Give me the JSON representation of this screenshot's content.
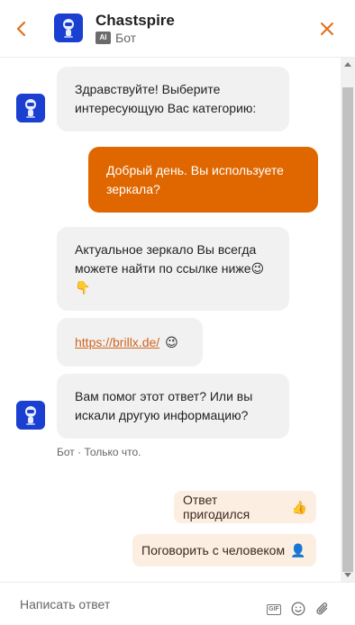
{
  "header": {
    "title": "Chastspire",
    "ai_badge": "AI",
    "subtitle": "Бот"
  },
  "messages": [
    {
      "sender": "bot",
      "text": "Здравствуйте! Выберите интересующую Вас категорию:"
    },
    {
      "sender": "user",
      "text": "Добрый день. Вы используете зеркала?"
    },
    {
      "sender": "bot",
      "text": "Актуальное зеркало Вы всегда можете найти по ссылке ниже",
      "emojis": "😉 👇"
    },
    {
      "sender": "bot",
      "link": "https://brillx.de/",
      "emoji": "😉"
    },
    {
      "sender": "bot",
      "text": "Вам помог этот ответ? Или вы искали другую информацию?"
    }
  ],
  "meta": "Бот · Только что.",
  "quick_replies": [
    {
      "label": "Ответ пригодился",
      "emoji": "👍"
    },
    {
      "label": "Поговорить с человеком",
      "emoji": "👤"
    }
  ],
  "composer": {
    "placeholder": "Написать ответ",
    "gif_label": "GIF"
  },
  "colors": {
    "accent": "#e06700",
    "bot_bubble": "#f1f1f1",
    "chip_bg": "#fdeee2",
    "avatar_bg": "#1b3fd0"
  },
  "icons": {
    "back": "chevron-left-icon",
    "close": "close-icon",
    "avatar": "robot-icon",
    "gif": "gif-icon",
    "emoji": "smiley-icon",
    "attach": "paperclip-icon"
  }
}
